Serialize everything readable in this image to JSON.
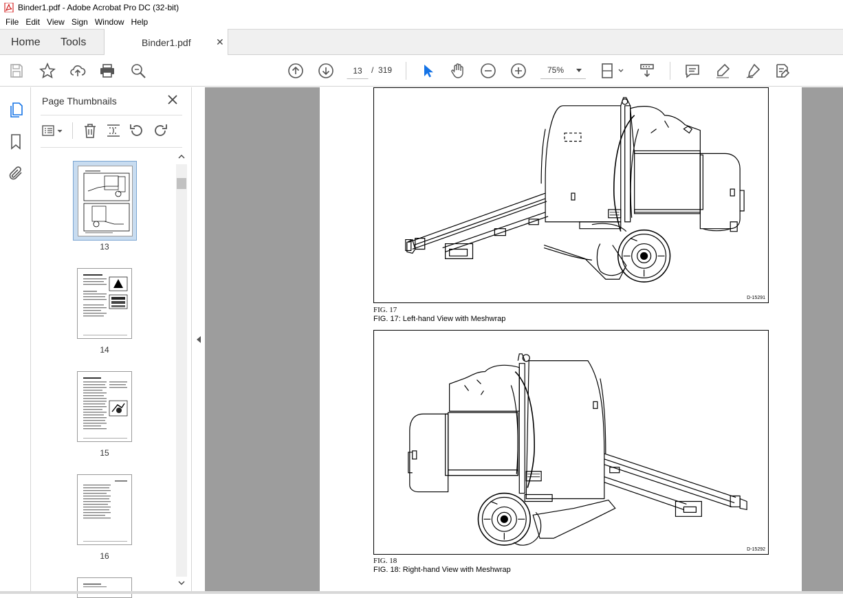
{
  "window": {
    "title": "Binder1.pdf - Adobe Acrobat Pro DC (32-bit)"
  },
  "menu": [
    "File",
    "Edit",
    "View",
    "Sign",
    "Window",
    "Help"
  ],
  "tabs": {
    "home": "Home",
    "tools": "Tools",
    "document": "Binder1.pdf"
  },
  "toolbar": {
    "current_page": "13",
    "page_separator": "/",
    "total_pages": "319",
    "zoom": "75%"
  },
  "panel": {
    "title": "Page Thumbnails",
    "thumbnails": [
      {
        "page": "13",
        "selected": true
      },
      {
        "page": "14",
        "selected": false
      },
      {
        "page": "15",
        "selected": false
      },
      {
        "page": "16",
        "selected": false
      }
    ]
  },
  "document": {
    "figures": [
      {
        "id": "D-15291",
        "label": "FIG. 17",
        "caption": "FIG. 17:  Left-hand View with Meshwrap"
      },
      {
        "id": "D-15292",
        "label": "FIG. 18",
        "caption": "FIG. 18:  Right-hand View with Meshwrap"
      }
    ]
  },
  "colors": {
    "accent": "#1473e6",
    "doc_background": "#9d9d9d",
    "select_highlight": "#c8dcf0"
  }
}
